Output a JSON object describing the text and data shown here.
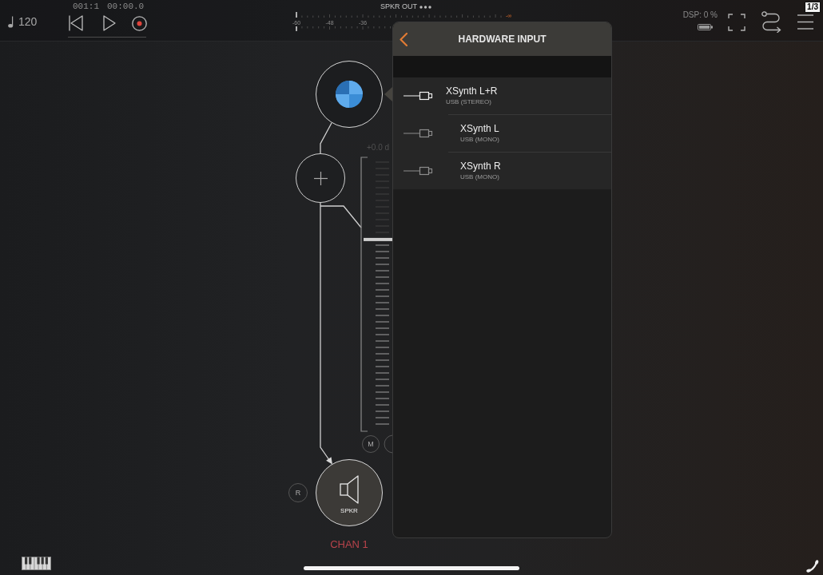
{
  "top_bar": {
    "tempo": "120",
    "position": "001:1",
    "time": "00:00.0",
    "meter": {
      "label": "SPKR OUT",
      "scale": [
        "-60",
        "-48",
        "-36"
      ],
      "peak": "-∞"
    },
    "dsp": "DSP: 0 %"
  },
  "page_badge": "1/3",
  "channel": {
    "fader": {
      "reading": "+0.0 d",
      "level": 0.7
    },
    "mute_button": "M",
    "side_button": "R",
    "output": {
      "label": "SPKR"
    },
    "name": "CHAN 1"
  },
  "popover": {
    "title": "HARDWARE INPUT",
    "inputs": [
      {
        "name": "XSynth L+R",
        "detail": "USB (STEREO)",
        "selected": true,
        "children": [
          {
            "name": "XSynth L",
            "detail": "USB (MONO)",
            "selected": false
          },
          {
            "name": "XSynth R",
            "detail": "USB (MONO)",
            "selected": false
          }
        ]
      }
    ]
  }
}
